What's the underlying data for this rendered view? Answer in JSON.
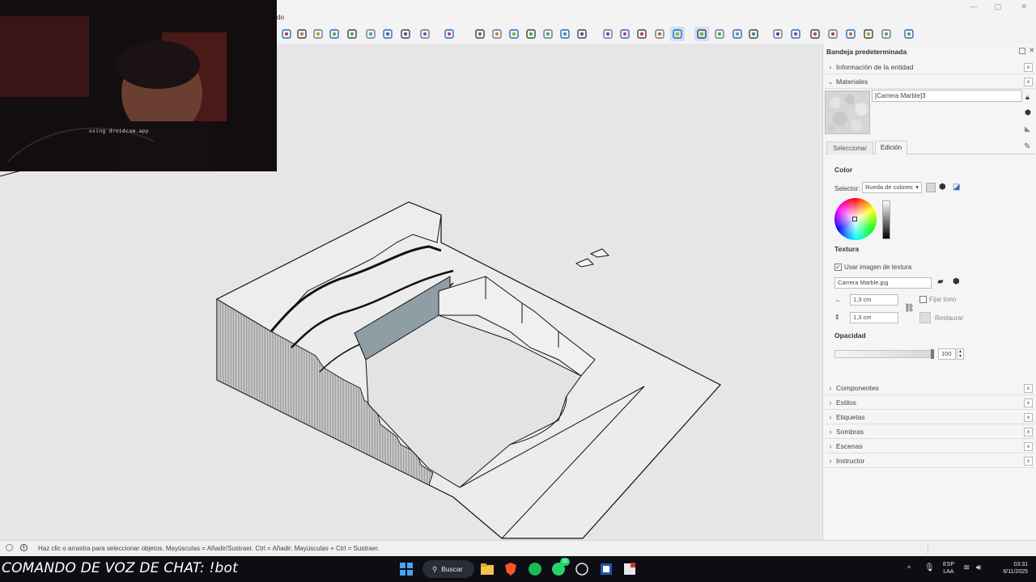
{
  "menu": {
    "fragment": "do"
  },
  "window_controls": [
    "—",
    "▢",
    "✕"
  ],
  "toolbar": {
    "icons": [
      "orbit-icon",
      "section-plane-icon",
      "paint-bucket-icon",
      "zoom-icon",
      "zoom-extents-icon",
      "tape-icon",
      "offset-icon",
      "follow-me-icon",
      "component-icon",
      "eye-icon",
      "iso-view-icon",
      "top-view-icon",
      "front-view-icon",
      "right-view-icon",
      "back-view-icon",
      "left-view-icon",
      "bottom-view-icon",
      "xray-icon",
      "back-edges-icon",
      "wireframe-icon",
      "hidden-line-icon",
      "shaded-icon",
      "textured-icon",
      "monochrome-icon",
      "warehouse-icon",
      "extension-icon",
      "ruby-icon",
      "sandbox-icon",
      "stamp-icon",
      "drape-icon",
      "add-detail-icon",
      "flip-edge-icon",
      "shadow-icon",
      "fog-icon",
      "extension-warehouse-icon"
    ]
  },
  "webcam": {
    "caption": "using droidcam.app"
  },
  "tray": {
    "title": "Bandeja predeterminada",
    "sections_top": [
      {
        "label": "Información de la entidad",
        "expanded": false
      },
      {
        "label": "Materiales",
        "expanded": true
      }
    ],
    "material": {
      "name": "[Carrera Marble]3",
      "tabs": [
        "Seleccionar",
        "Edición"
      ],
      "active_tab": "Edición",
      "color_heading": "Color",
      "selector_label": "Selector:",
      "selector_value": "Rueda de colores",
      "texture_heading": "Textura",
      "use_texture_label": "Usar imagen de textura",
      "use_texture_checked": true,
      "texture_file": "Carrera Marble.jpg",
      "width_value": "1,3 cm",
      "height_value": "1,3 cm",
      "colorize_label": "Fijar tono",
      "reset_label": "Restaurar",
      "opacity_heading": "Opacidad",
      "opacity_value": "100"
    },
    "sections_bottom": [
      {
        "label": "Componentes"
      },
      {
        "label": "Estilos"
      },
      {
        "label": "Etiquetas"
      },
      {
        "label": "Sombras"
      },
      {
        "label": "Escenas"
      },
      {
        "label": "Instructor"
      }
    ]
  },
  "status": {
    "text": "Haz clic o arrastra para seleccionar objetos. Mayúsculas = Añadir/Sustraer. Ctrl = Añadir. Mayúsculas + Ctrl = Sustraer."
  },
  "taskbar": {
    "chat_command": "COMANDO DE VOZ DE CHAT: !bot",
    "search_label": "Buscar",
    "whatsapp_badge": "32",
    "language": "ESP",
    "language_sub": "LAA",
    "time": "03:31",
    "date": "6/11/2025"
  },
  "colors": {
    "accent": "#2d6bb5",
    "viewport": "#e6e6e6",
    "taskbar": "#0c0e14",
    "section_cut": "#8f9ea5"
  }
}
